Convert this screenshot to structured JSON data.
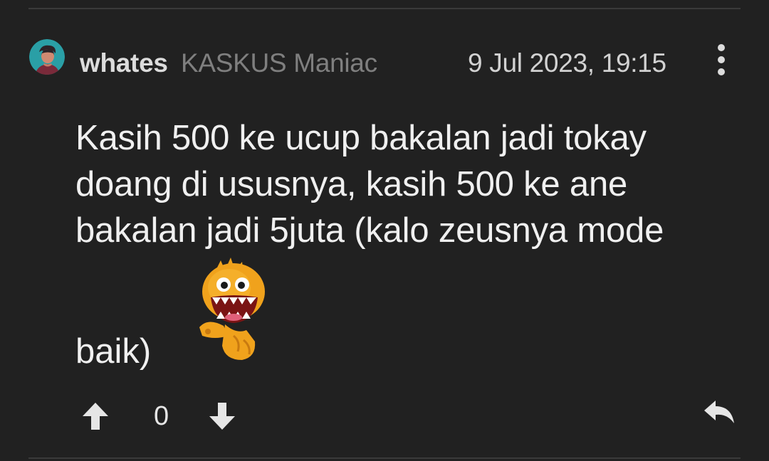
{
  "post": {
    "author": {
      "username": "whates",
      "rank": "KASKUS Maniac",
      "avatar_icon": "user-avatar-icon"
    },
    "timestamp": "9 Jul 2023, 19:15",
    "body_lines": [
      "Kasih 500 ke ucup bakalan jadi tokay",
      "doang di ususnya, kasih 500 ke ane",
      "bakalan jadi 5juta (kalo zeusnya mode"
    ],
    "body_last": "baik)",
    "emoticon": "grinning-orange-monster-emoticon",
    "votes": {
      "count": "0",
      "upvote_icon": "arrow-up-icon",
      "downvote_icon": "arrow-down-icon"
    },
    "reply_icon": "reply-icon",
    "more_icon": "more-vertical-icon"
  },
  "colors": {
    "background": "#212121",
    "text": "#f0f0f0",
    "rank": "#7f7f7f",
    "divider": "#3a3a3a",
    "emoticon": "#f0a21c"
  }
}
